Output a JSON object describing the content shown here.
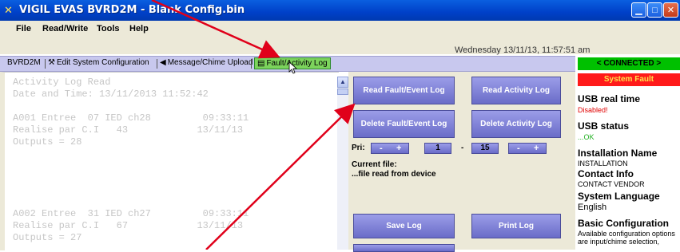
{
  "window": {
    "title": "VIGIL EVAS BVRD2M - Blank Config.bin",
    "app_icon": "app-logo-icon",
    "controls": [
      "minimize-icon",
      "maximize-icon",
      "close-icon"
    ]
  },
  "menu": {
    "file": "File",
    "readwrite": "Read/Write",
    "tools": "Tools",
    "help": "Help"
  },
  "datetime": "Wednesday 13/11/13, 11:57:51 am",
  "tabs": {
    "bvrd2m": "BVRD2M",
    "edit": "Edit System Configuration",
    "message": "Message/Chime Upload",
    "fault": "Fault/Activity Log"
  },
  "log": {
    "text": "Activity Log Read\nDate and Time: 13/11/2013 11:52:42\n\nA001 Entree  07 IED ch28         09:33:11\nRealise par C.I   43            13/11/13\nOutputs = 28\n\n\n\n\n\nA002 Entree  31 IED ch27         09:33:11\nRealise par C.I   67            13/11/13\nOutputs = 27"
  },
  "buttons": {
    "read_fault": "Read Fault/Event Log",
    "read_activity": "Read Activity Log",
    "delete_fault": "Delete Fault/Event Log",
    "delete_activity": "Delete Activity Log",
    "save": "Save Log",
    "print": "Print Log"
  },
  "priority": {
    "label": "Pri:",
    "minus": "-",
    "plus": "+",
    "from": "1",
    "separator": "-",
    "to": "15"
  },
  "current_file": {
    "label": "Current file:",
    "value": "...file read from device"
  },
  "sidebar": {
    "connected": "< CONNECTED >",
    "fault": "System Fault",
    "usb_realtime_label": "USB real time",
    "usb_realtime_value": "Disabled!",
    "usb_status_label": "USB status",
    "usb_status_value": "...OK",
    "install_name_label": "Installation Name",
    "install_name_value": "INSTALLATION",
    "contact_label": "Contact Info",
    "contact_value": "CONTACT VENDOR",
    "language_label": "System Language",
    "language_value": "English",
    "basic_label": "Basic Configuration",
    "basic_value_1": "Available configuration options",
    "basic_value_2": "are input/chime selection,"
  },
  "colors": {
    "connected": "#00c000",
    "fault": "#ff1a1a",
    "disabled_text": "#e00000",
    "ok_text": "#22b022",
    "annotation_arrow": "#e0001a"
  }
}
